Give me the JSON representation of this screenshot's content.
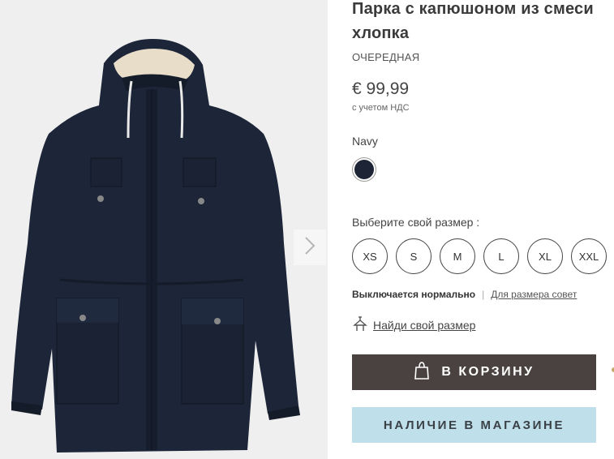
{
  "product": {
    "title_line1": "Парка с капюшоном из смеси",
    "title_line2": "хлопка",
    "fit_type": "ОЧЕРЕДНАЯ",
    "price": "€ 99,99",
    "vat_note": "с учетом НДС"
  },
  "color": {
    "name": "Navy",
    "swatch_hex": "#1c2436"
  },
  "sizes": {
    "label": "Выберите свой размер :",
    "options": [
      "XS",
      "S",
      "M",
      "L",
      "XL",
      "XXL"
    ]
  },
  "fit": {
    "note": "Выключается нормально",
    "separator": "|",
    "advice_link": "Для размера совет"
  },
  "find_size": {
    "label": "Найди свой размер",
    "icon": "hanger-icon"
  },
  "actions": {
    "cart_label": "В КОРЗИНУ",
    "cart_icon": "shopping-bag-icon",
    "store_label": "НАЛИЧИЕ В МАГАЗИНЕ"
  },
  "gallery": {
    "next_icon": "chevron-right-icon"
  },
  "colors": {
    "cart_button": "#4a4240",
    "store_button": "#bfe0ea",
    "gallery_bg": "#efefef"
  }
}
